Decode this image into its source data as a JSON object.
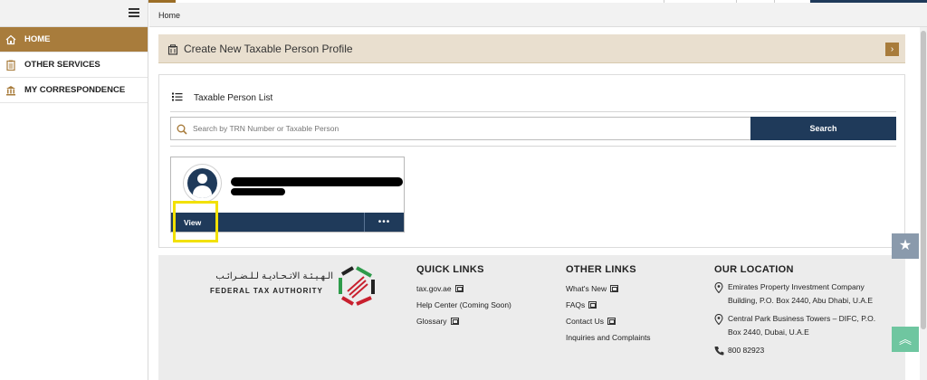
{
  "sidebar": {
    "items": [
      {
        "label": "HOME",
        "icon": "home-icon",
        "active": true
      },
      {
        "label": "OTHER SERVICES",
        "icon": "clipboard-icon",
        "active": false
      },
      {
        "label": "MY CORRESPONDENCE",
        "icon": "building-icon",
        "active": false
      }
    ]
  },
  "breadcrumb": {
    "current": "Home"
  },
  "create_profile": {
    "label": "Create New Taxable Person Profile",
    "icon": "profile-card-icon",
    "arrow_icon": "chevron-right-icon"
  },
  "person_list": {
    "title": "Taxable Person List",
    "search": {
      "placeholder": "Search by TRN Number or Taxable Person",
      "value": "",
      "button_label": "Search"
    },
    "card": {
      "view_label": "View",
      "more_label": "•••"
    }
  },
  "footer": {
    "logo": {
      "arabic": "الـهـيـئـة الاتـحـاديـة لـلـضـرائـب",
      "english": "FEDERAL TAX AUTHORITY"
    },
    "quick_links": {
      "heading": "QUICK LINKS",
      "items": [
        "tax.gov.ae",
        "Help Center (Coming Soon)",
        "Glossary"
      ]
    },
    "other_links": {
      "heading": "OTHER LINKS",
      "items": [
        "What's New",
        "FAQs",
        "Contact Us",
        "Inquiries and Complaints"
      ]
    },
    "location": {
      "heading": "OUR LOCATION",
      "addresses": [
        "Emirates Property Investment Company Building, P.O. Box 2440, Abu Dhabi, U.A.E",
        "Central Park Business Towers – DIFC, P.O. Box 2440, Dubai, U.A.E"
      ],
      "phone": "800 82923"
    }
  },
  "colors": {
    "accent_gold": "#a87c3c",
    "navy": "#1f3a5a",
    "highlight": "#f2e100"
  }
}
